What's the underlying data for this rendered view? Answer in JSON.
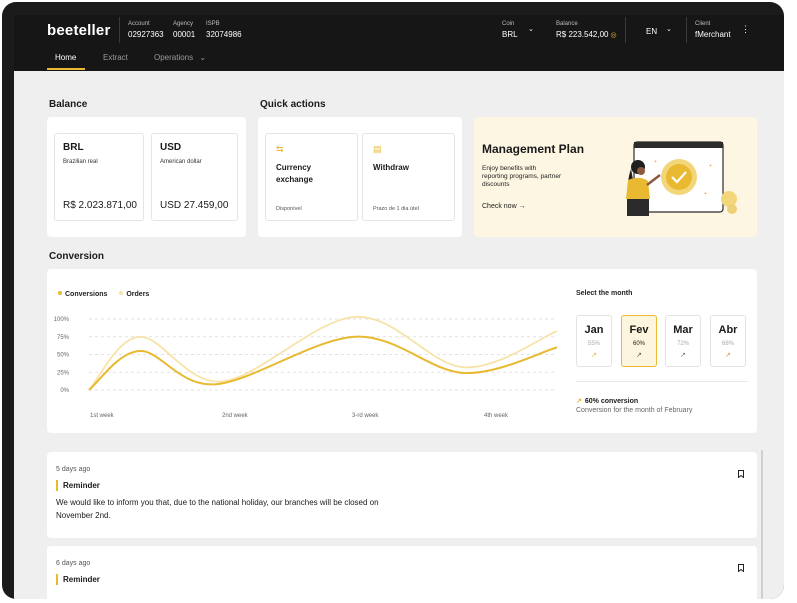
{
  "header": {
    "logo": "beeteller",
    "account": {
      "label": "Account",
      "value": "02927363"
    },
    "agency": {
      "label": "Agency",
      "value": "00001"
    },
    "ispb": {
      "label": "ISPB",
      "value": "32074986"
    },
    "coin": {
      "label": "Coin",
      "value": "BRL"
    },
    "balance": {
      "label": "Balance",
      "value": "R$ 223.542,00"
    },
    "language": "EN",
    "client": {
      "label": "Client",
      "value": "fMerchant"
    }
  },
  "nav": {
    "home": "Home",
    "extract": "Extract",
    "operations": "Operations"
  },
  "balance": {
    "title": "Balance",
    "cards": [
      {
        "code": "BRL",
        "name": "Brazilian real",
        "amount": "R$ 2.023.871,00"
      },
      {
        "code": "USD",
        "name": "American dollar",
        "amount": "USD 27.459,00"
      }
    ]
  },
  "quick_actions": {
    "title": "Quick actions",
    "items": [
      {
        "title": "Currency exchange",
        "subtitle": "Disponível"
      },
      {
        "title": "Withdraw",
        "subtitle": "Prazo de 1 dia útel"
      }
    ]
  },
  "management_plan": {
    "title": "Management Plan",
    "description": "Enjoy benefits with reporting programs, partner discounts",
    "link": "Check now"
  },
  "conversion": {
    "title": "Conversion",
    "select_label": "Select the month",
    "months": [
      {
        "name": "Jan",
        "pct": "55%"
      },
      {
        "name": "Fev",
        "pct": "60%"
      },
      {
        "name": "Mar",
        "pct": "72%"
      },
      {
        "name": "Abr",
        "pct": "68%"
      }
    ],
    "summary": "60% conversion",
    "summary_desc": "Conversion for the month of February"
  },
  "chart_data": {
    "type": "line",
    "legend": [
      "Conversions",
      "Orders"
    ],
    "y_ticks": [
      "100%",
      "75%",
      "50%",
      "25%",
      "0%"
    ],
    "x_ticks": [
      "1st week",
      "2nd week",
      "3-rd week",
      "4th week"
    ],
    "ylim": [
      0,
      100
    ],
    "colors": {
      "Conversions": "#e8b931",
      "Orders": "#f7e3a8"
    },
    "series": [
      {
        "name": "Conversions",
        "x": [
          0,
          0.7,
          1.75,
          3.7,
          5.2,
          6.5
        ],
        "y": [
          0,
          55,
          8,
          75,
          24,
          60
        ]
      },
      {
        "name": "Orders",
        "x": [
          0,
          0.7,
          1.85,
          3.7,
          5.2,
          6.5
        ],
        "y": [
          0,
          75,
          12,
          103,
          32,
          83
        ]
      }
    ]
  },
  "notifications": [
    {
      "time": "5 days ago",
      "title": "Reminder",
      "body": "We would like to inform you that, due to the national holiday, our branches will be closed on November 2nd."
    },
    {
      "time": "6 days ago",
      "title": "Reminder",
      "body": ""
    }
  ]
}
